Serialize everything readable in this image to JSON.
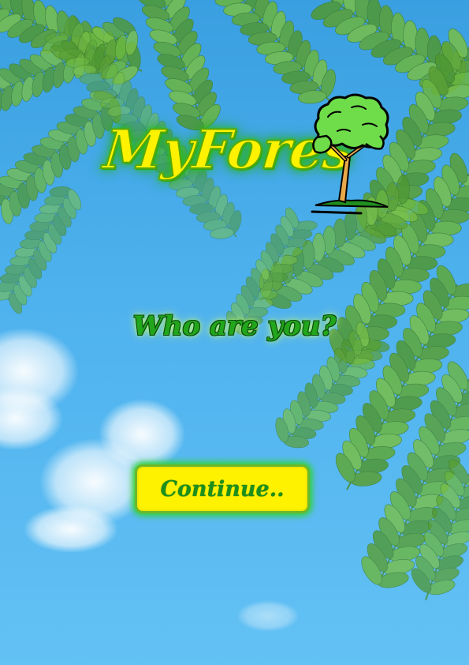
{
  "app": {
    "logo_text": "MyFores",
    "logo_icon": "tree-icon"
  },
  "main": {
    "question": "Who are you?",
    "continue_label": "Continue.."
  },
  "colors": {
    "sky": "#4eb2ee",
    "leaf": "#6aae3a",
    "logo_yellow": "#fff200",
    "glow_green": "#2ec11c",
    "button_yellow": "#fff200",
    "text_green": "#22a61c"
  }
}
